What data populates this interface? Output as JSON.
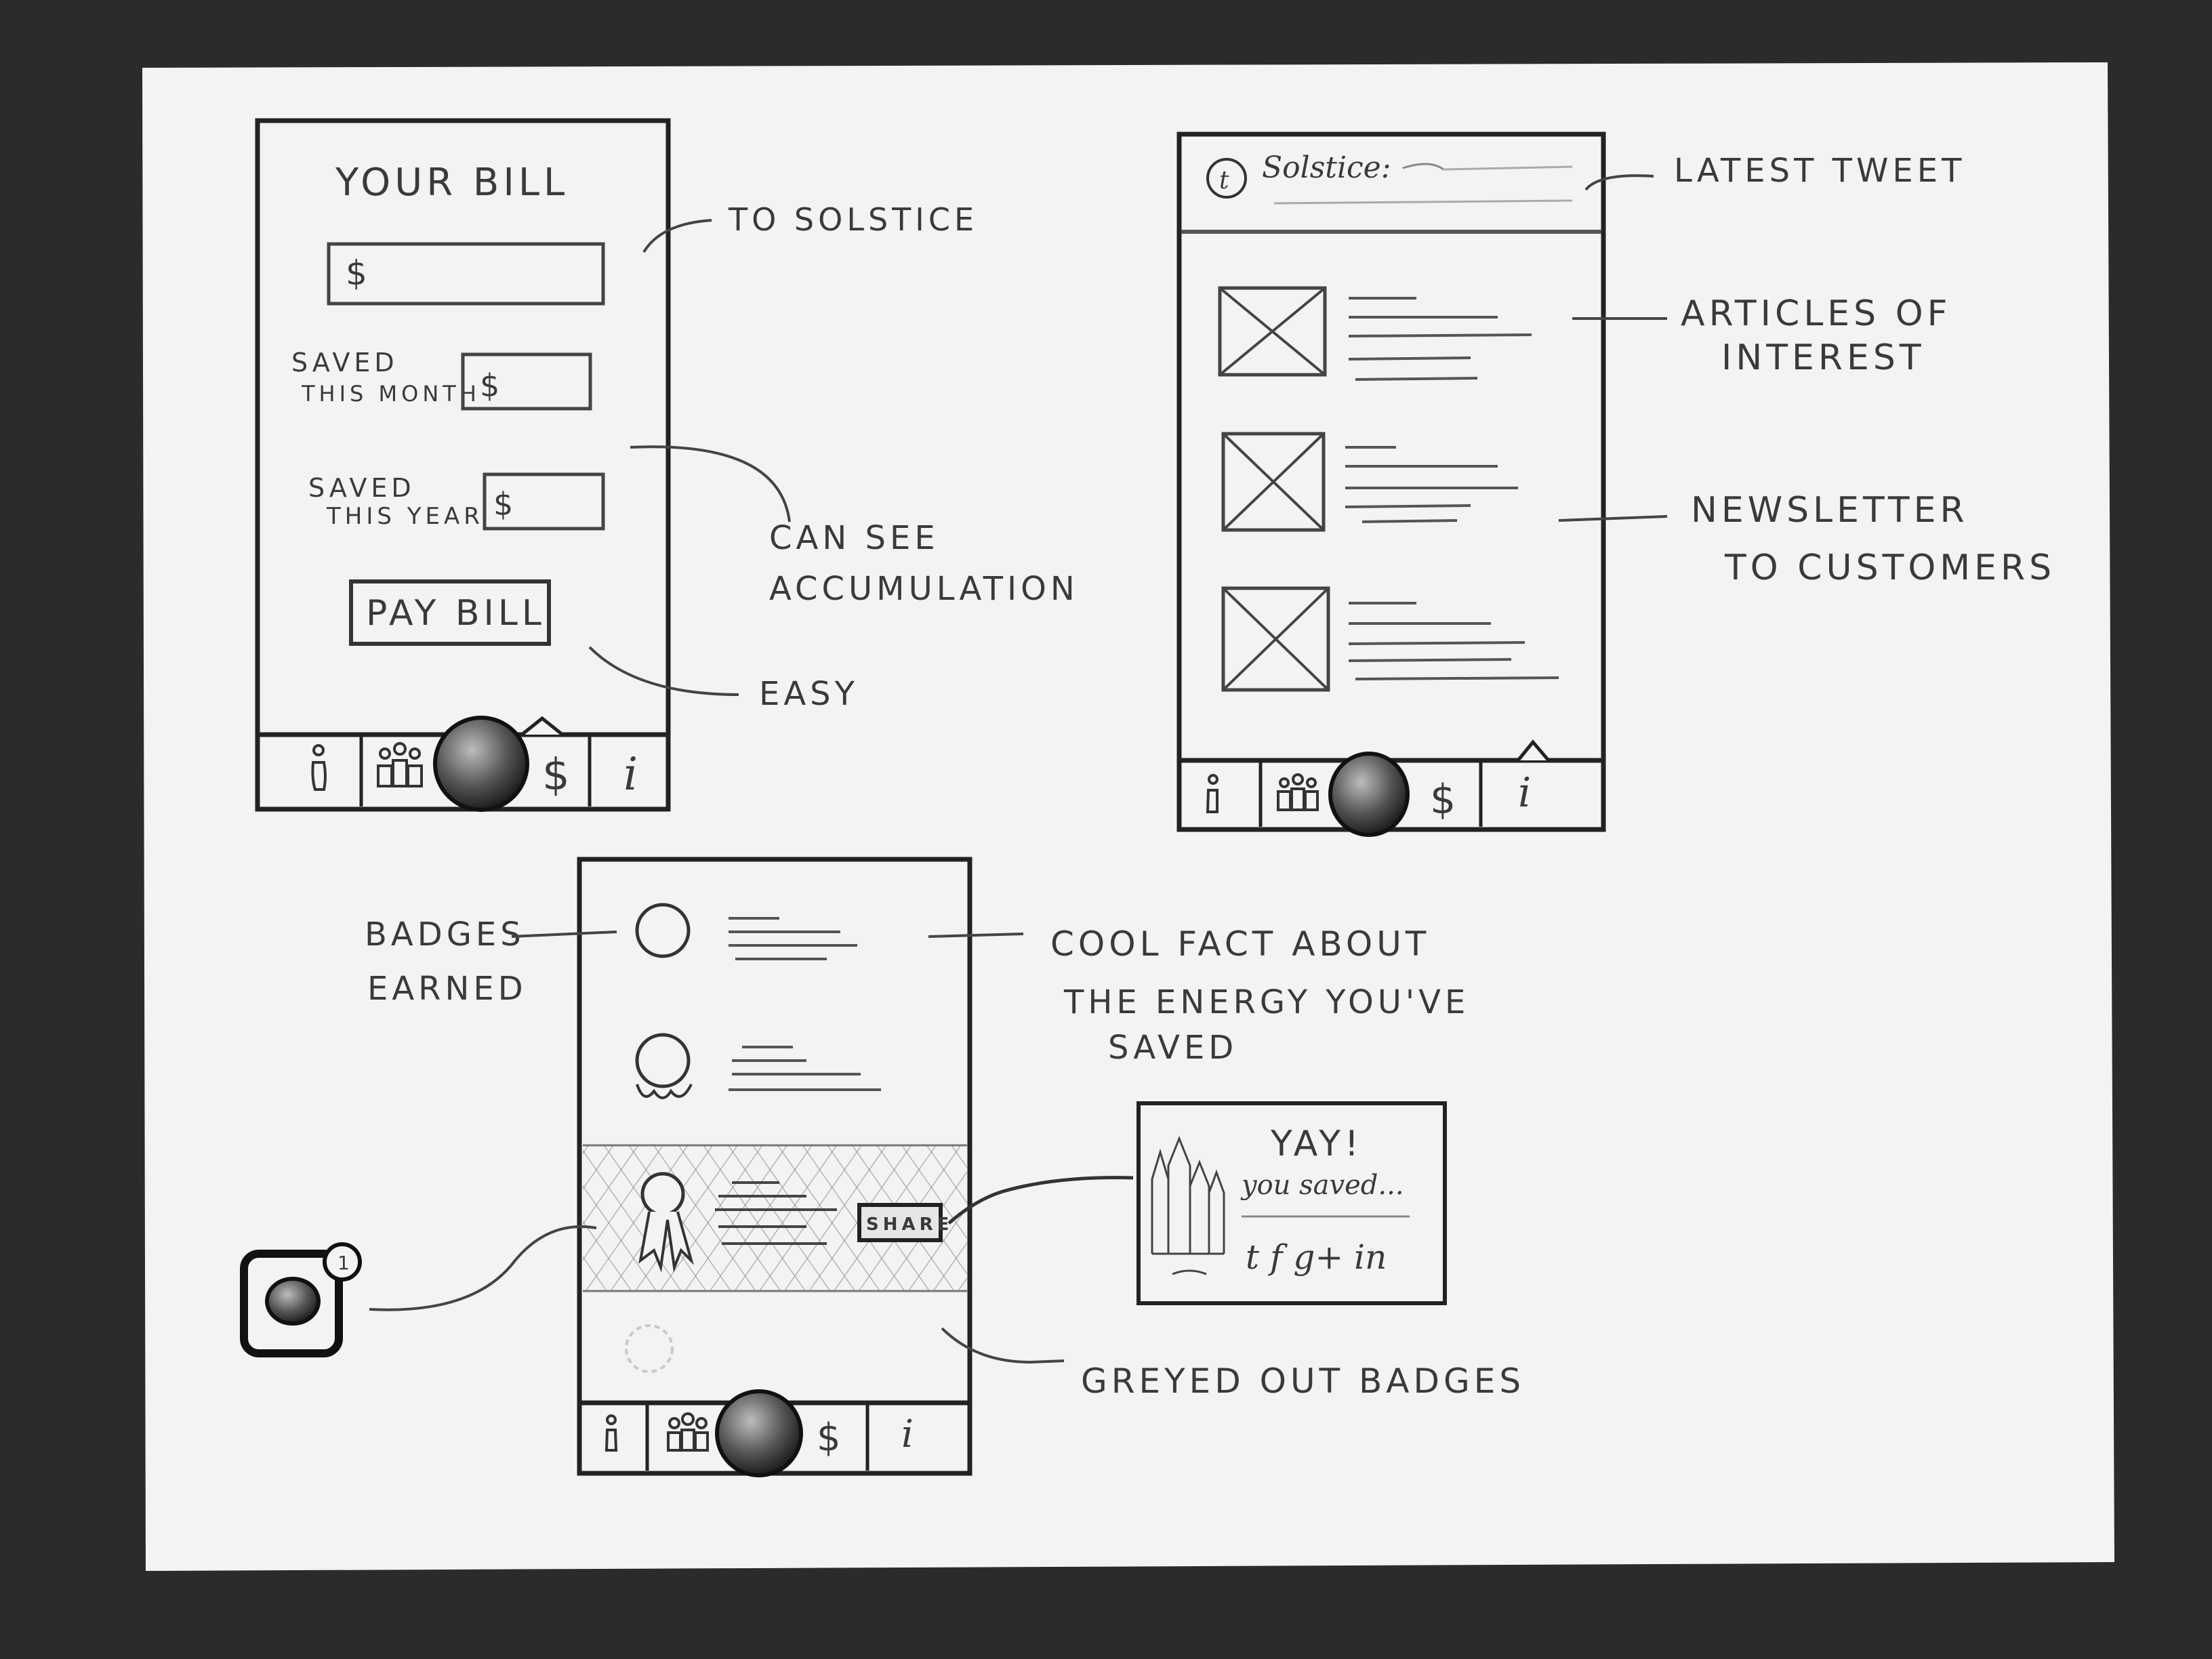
{
  "screens": {
    "bill": {
      "title": "YOUR BILL",
      "amount_field": "$",
      "saved_month_label_1": "SAVED",
      "saved_month_label_2": "THIS MONTH",
      "saved_month_field": "$",
      "saved_year_label_1": "SAVED",
      "saved_year_label_2": "THIS YEAR",
      "saved_year_field": "$",
      "pay_button": "PAY BILL"
    },
    "news": {
      "tweet_text": "Solstice:"
    },
    "badges": {
      "share_button": "SHARE"
    }
  },
  "tab_bar": {
    "dollar": "$",
    "info": "i"
  },
  "share_card": {
    "title": "YAY!",
    "subtitle": "you saved...",
    "social": "t  f  g+  in"
  },
  "app_icon": {
    "badge_count": "1"
  },
  "annotations": {
    "to_solstice": "TO SOLSTICE",
    "can_see_1": "CAN SEE",
    "can_see_2": "ACCUMULATION",
    "easy": "EASY",
    "latest_tweet": "LATEST TWEET",
    "articles_1": "ARTICLES OF",
    "articles_2": "INTEREST",
    "newsletter_1": "NEWSLETTER",
    "newsletter_2": "TO CUSTOMERS",
    "badges_1": "BADGES",
    "badges_2": "EARNED",
    "cool_fact_1": "COOL FACT ABOUT",
    "cool_fact_2": "THE ENERGY YOU'VE",
    "cool_fact_3": "SAVED",
    "greyed_out": "GREYED OUT BADGES"
  },
  "colors": {
    "background": "#2b2b2b",
    "paper": "#f4f4f4",
    "ink": "#2a2a2a",
    "pencil": "#555555"
  }
}
